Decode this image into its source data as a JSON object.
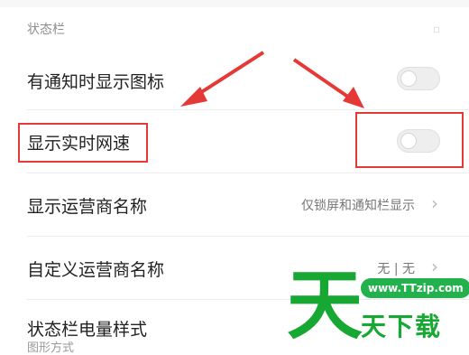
{
  "section": {
    "header": "状态栏"
  },
  "rows": [
    {
      "label": "有通知时显示图标",
      "control": "toggle",
      "state": "off"
    },
    {
      "label": "显示实时网速",
      "control": "toggle",
      "state": "off"
    },
    {
      "label": "显示运营商名称",
      "value": "仅锁屏和通知栏显示",
      "control": "chevron"
    },
    {
      "label": "自定义运营商名称",
      "value": "无 | 无",
      "control": "chevron"
    },
    {
      "label": "状态栏电量样式",
      "sublabel": "图形方式",
      "control": "chevron"
    }
  ],
  "watermark": {
    "big_char": "天",
    "url": "www.TTzip.com",
    "text": "天下载"
  },
  "colors": {
    "annotation_red": "#e53935",
    "watermark_green": "#16a832",
    "toggle_off": "#eeeeee"
  }
}
